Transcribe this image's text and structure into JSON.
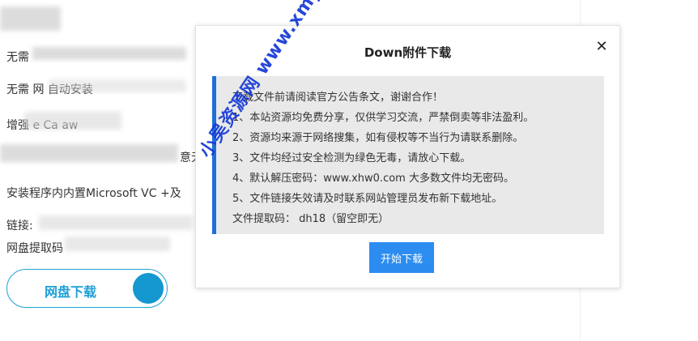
{
  "background": {
    "lines": [
      "无需",
      "无需 网 自动安装",
      "增强 e Ca aw",
      "意无",
      "安装程序内内置Microsoft VC +及",
      "链接:",
      "网盘提取码"
    ],
    "netdisk_button_label": "网盘下载"
  },
  "modal": {
    "title": "Down附件下载",
    "close_icon": "close-icon",
    "notice_lines": [
      "下载文件前请阅读官方公告条文，谢谢合作！",
      "1、本站资源均免费分享，仅供学习交流，严禁倒卖等非法盈利。",
      "2、资源均来源于网络搜集，如有侵权等不当行为请联系删除。",
      "3、文件均经过安全检测为绿色无毒，请放心下载。",
      "4、默认解压密码：www.xhw0.com 大多数文件均无密码。",
      "5、文件链接失效请及时联系网站管理员发布新下载地址。",
      "文件提取码： dh18（留空即无）"
    ],
    "start_button_label": "开始下载"
  },
  "watermark": "小吴资源网 www.xmy7.com",
  "colors": {
    "accent_blue": "#2d8cf0",
    "notice_border": "#1e6fd9",
    "netdisk_blue": "#1e9fd6",
    "watermark": "#1438d6"
  }
}
